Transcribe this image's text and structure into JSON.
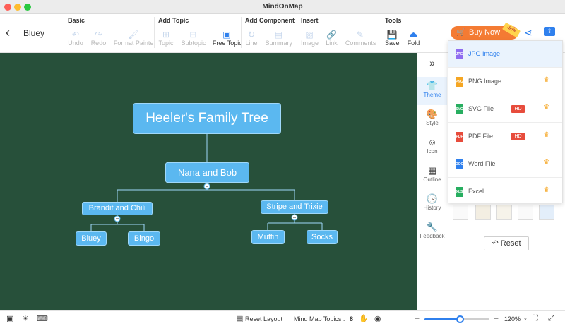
{
  "window": {
    "title": "MindOnMap"
  },
  "header": {
    "back_label": "‹",
    "doc_title": "Bluey"
  },
  "toolbar": {
    "groups": [
      {
        "label": "Basic",
        "items": [
          {
            "label": "Undo",
            "icon": "↶"
          },
          {
            "label": "Redo",
            "icon": "↷"
          },
          {
            "label": "Format Painter",
            "icon": "🖌"
          }
        ]
      },
      {
        "label": "Add Topic",
        "items": [
          {
            "label": "Topic",
            "icon": "⊞"
          },
          {
            "label": "Subtopic",
            "icon": "⊟"
          },
          {
            "label": "Free Topic",
            "icon": "▣"
          }
        ]
      },
      {
        "label": "Add Component",
        "items": [
          {
            "label": "Line",
            "icon": "↻"
          },
          {
            "label": "Summary",
            "icon": "▤"
          }
        ]
      },
      {
        "label": "Insert",
        "items": [
          {
            "label": "Image",
            "icon": "▨"
          },
          {
            "label": "Link",
            "icon": "🔗"
          },
          {
            "label": "Comments",
            "icon": "✎"
          }
        ]
      },
      {
        "label": "Tools",
        "items": [
          {
            "label": "Save",
            "icon": "💾"
          },
          {
            "label": "Fold",
            "icon": "⏏"
          }
        ]
      }
    ],
    "buy_now_label": "Buy Now",
    "discount_badge": "-80%",
    "share_icon": "⋖",
    "export_icon": "⇪"
  },
  "mindmap": {
    "root": "Heeler's Family Tree",
    "level1": "Nana and Bob",
    "left_branch": "Brandit and Chili",
    "right_branch": "Stripe and Trixie",
    "left_children": [
      "Bluey",
      "Bingo"
    ],
    "right_children": [
      "Muffin",
      "Socks"
    ]
  },
  "side_rail": {
    "collapse_icon": "»",
    "items": [
      {
        "label": "Theme",
        "icon": "👕"
      },
      {
        "label": "Style",
        "icon": "🎨"
      },
      {
        "label": "Icon",
        "icon": "☺"
      },
      {
        "label": "Outline",
        "icon": "▦"
      },
      {
        "label": "History",
        "icon": "🕓"
      },
      {
        "label": "Feedback",
        "icon": "🔧"
      }
    ]
  },
  "theme_panel": {
    "reset_label": "Reset",
    "reset_icon": "↶"
  },
  "export_menu": {
    "items": [
      {
        "label": "JPG Image",
        "file_tag": "JPG",
        "color": "#8e6cf0",
        "hd": "",
        "crown": ""
      },
      {
        "label": "PNG Image",
        "file_tag": "PNG",
        "color": "#f5a623",
        "hd": "",
        "crown": "♛"
      },
      {
        "label": "SVG File",
        "file_tag": "SVG",
        "color": "#27ae60",
        "hd": "HD",
        "crown": "♛"
      },
      {
        "label": "PDF File",
        "file_tag": "PDF",
        "color": "#e74c3c",
        "hd": "HD",
        "crown": "♛"
      },
      {
        "label": "Word File",
        "file_tag": "DOC",
        "color": "#2f80ed",
        "hd": "",
        "crown": "♛"
      },
      {
        "label": "Excel",
        "file_tag": "XLS",
        "color": "#27ae60",
        "hd": "",
        "crown": "♛"
      }
    ]
  },
  "statusbar": {
    "reset_layout_label": "Reset Layout",
    "topics_label": "Mind Map Topics :",
    "topics_count": "8",
    "zoom_minus": "−",
    "zoom_plus": "+",
    "zoom_level": "120%",
    "zoom_fraction": 0.55
  },
  "colors": {
    "canvas_bg": "#27503a",
    "node_fill": "#5bb8f0",
    "accent": "#2f80ed",
    "buy_button": "#f47b33"
  }
}
